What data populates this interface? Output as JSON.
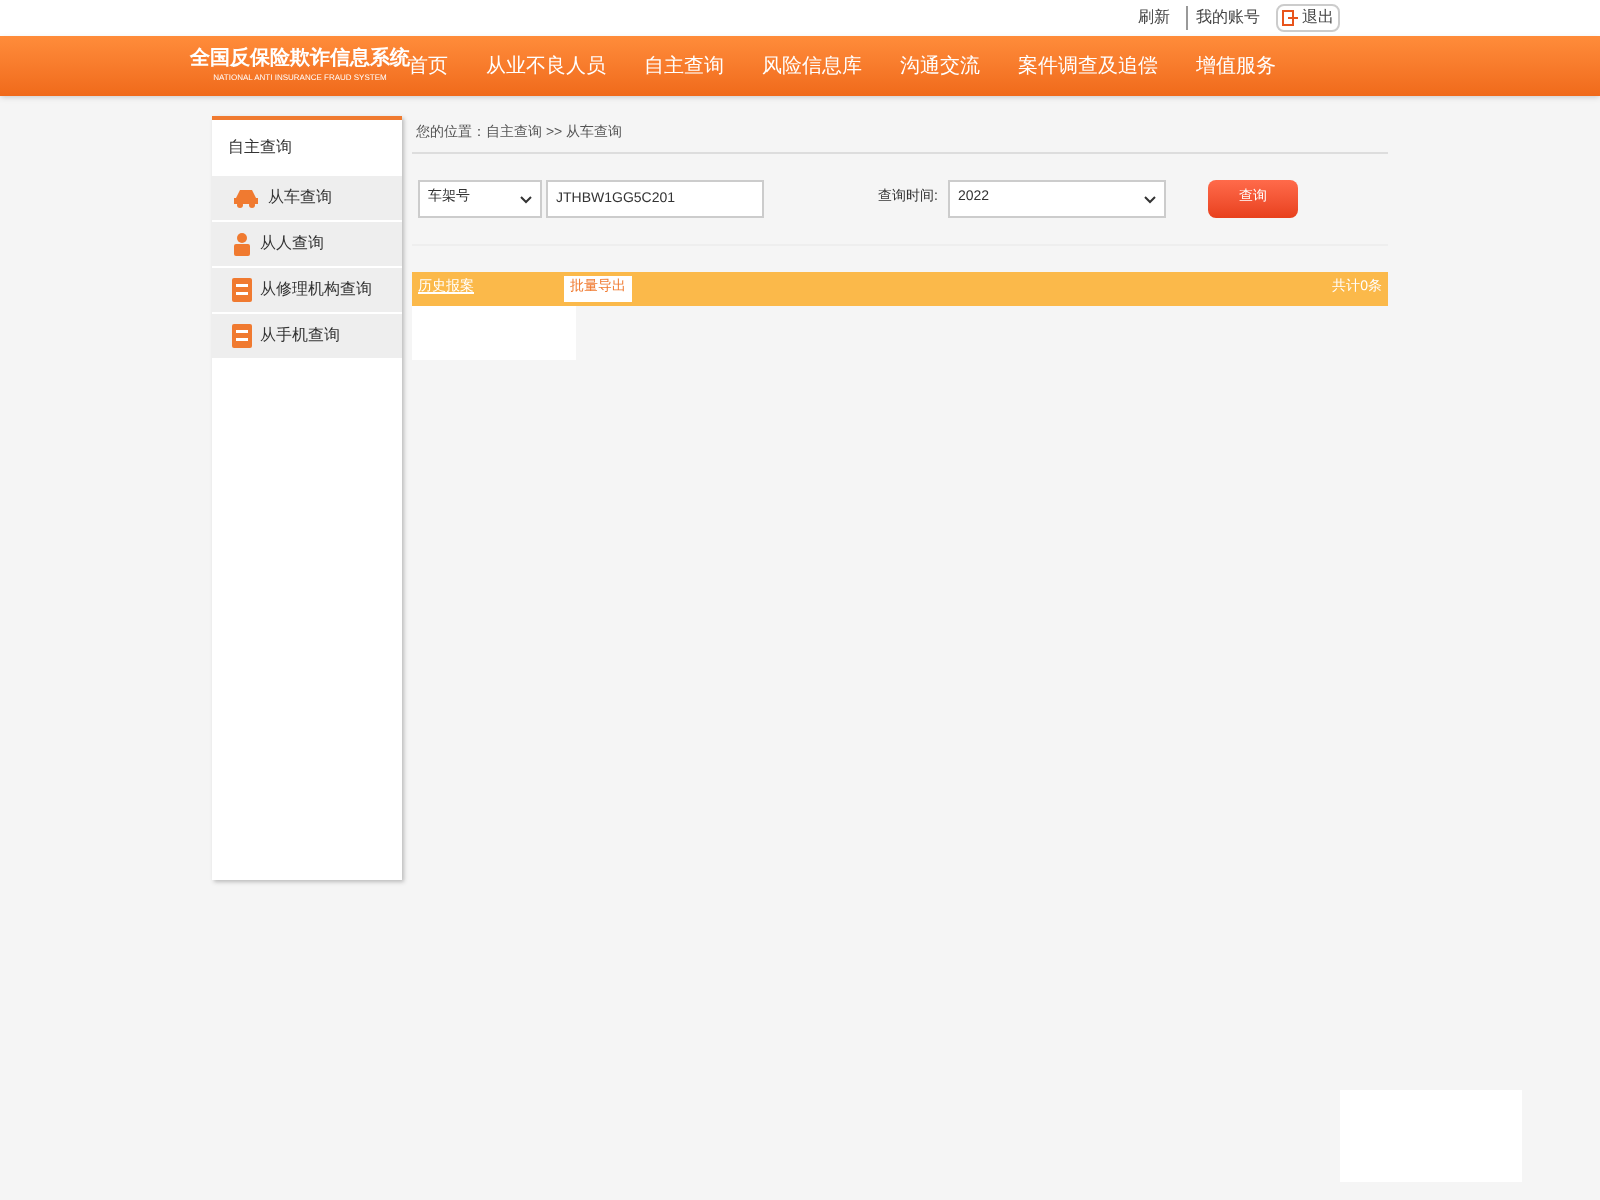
{
  "top_links": [
    "刷新",
    "我的账号"
  ],
  "logout": "退出",
  "logo": {
    "title": "全国反保险欺诈信息系统",
    "subtitle": "NATIONAL ANTI INSURANCE FRAUD SYSTEM"
  },
  "nav": [
    "首页",
    "从业不良人员",
    "自主查询",
    "风险信息库",
    "沟通交流",
    "案件调查及追偿",
    "增值服务"
  ],
  "sidebar": {
    "title": "自主查询",
    "items": [
      {
        "label": "从车查询",
        "kind": "car"
      },
      {
        "label": "从人查询",
        "kind": "person"
      },
      {
        "label": "从修理机构查询",
        "kind": "doc"
      },
      {
        "label": "从手机查询",
        "kind": "doc"
      }
    ]
  },
  "breadcrumb": "您的位置：自主查询 >> 从车查询",
  "form": {
    "type_select": "车架号",
    "value": "JTHBW1GG5C201",
    "time_label": "查询时间:",
    "year_select": "2022",
    "search_button": "查询"
  },
  "result_bar": {
    "title": "历史报案",
    "export_button": "批量导出",
    "count": "共计0条"
  }
}
